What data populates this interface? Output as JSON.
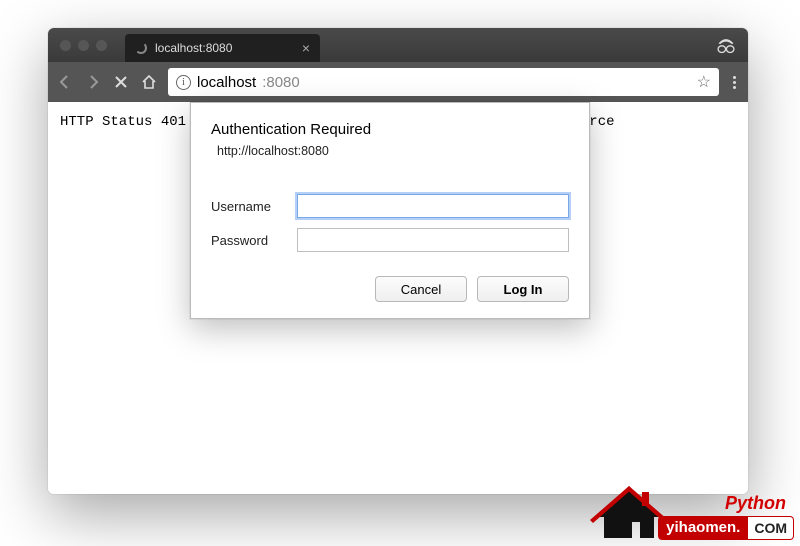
{
  "tab": {
    "title": "localhost:8080"
  },
  "address": {
    "host": "localhost",
    "port": ":8080"
  },
  "page": {
    "status_prefix": "HTTP Status 401 :",
    "status_suffix": "esource"
  },
  "dialog": {
    "title": "Authentication Required",
    "origin": "http://localhost:8080",
    "username_label": "Username",
    "password_label": "Password",
    "username_value": "",
    "password_value": "",
    "cancel_label": "Cancel",
    "login_label": "Log In"
  },
  "watermark": {
    "lang": "Python",
    "site": "yihaomen.",
    "tld": "COM"
  }
}
